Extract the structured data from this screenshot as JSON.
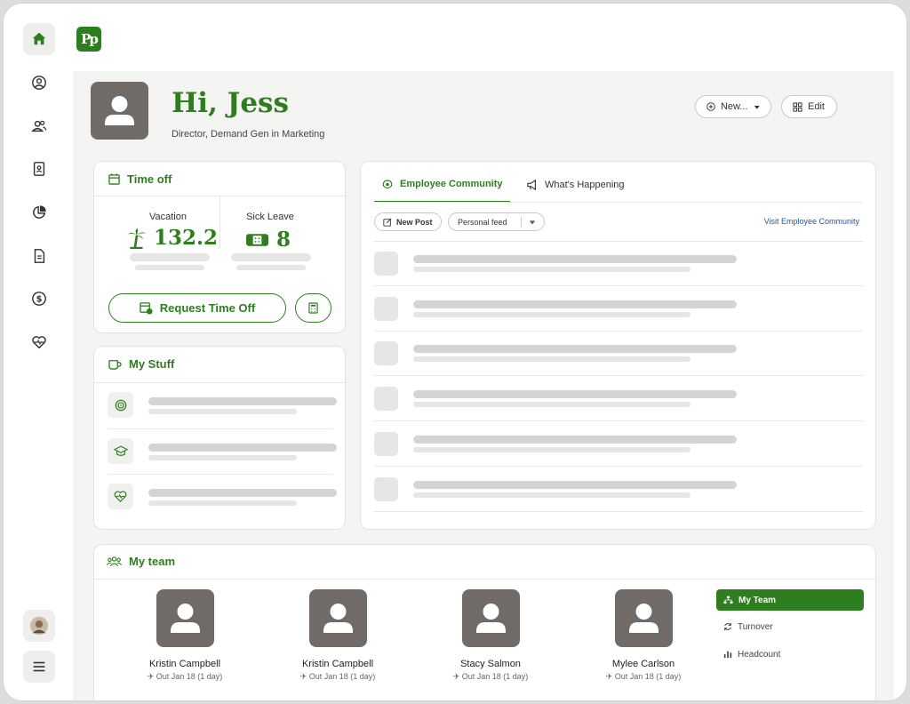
{
  "colors": {
    "brand": "#2e7d1e",
    "link": "#2456a6",
    "avatar": "#706b67"
  },
  "logo": {
    "text": "Pp"
  },
  "sidebar": {
    "items": [
      {
        "icon": "home-icon"
      },
      {
        "icon": "user-circle-icon"
      },
      {
        "icon": "people-icon"
      },
      {
        "icon": "contact-card-icon"
      },
      {
        "icon": "pie-chart-icon"
      },
      {
        "icon": "document-icon"
      },
      {
        "icon": "dollar-icon"
      },
      {
        "icon": "heart-pulse-icon"
      }
    ]
  },
  "header": {
    "greeting": "Hi, Jess",
    "subtitle": "Director, Demand Gen in Marketing",
    "new_label": "New...",
    "edit_label": "Edit"
  },
  "time_off": {
    "title": "Time off",
    "vacation_label": "Vacation",
    "vacation_value": "132.2",
    "sick_label": "Sick Leave",
    "sick_value": "8",
    "request_label": "Request Time Off"
  },
  "my_stuff": {
    "title": "My Stuff"
  },
  "community": {
    "tab_community": "Employee Community",
    "tab_happening": "What's Happening",
    "new_post": "New Post",
    "feed_select": "Personal feed",
    "visit_link": "Visit Employee Community"
  },
  "team": {
    "title": "My team",
    "members": [
      {
        "name": "Kristin Campbell",
        "status": "Out Jan 18 (1 day)"
      },
      {
        "name": "Kristin Campbell",
        "status": "Out Jan 18 (1 day)"
      },
      {
        "name": "Stacy Salmon",
        "status": "Out Jan 18 (1 day)"
      },
      {
        "name": "Mylee Carlson",
        "status": "Out Jan 18 (1 day)"
      }
    ],
    "options": {
      "my_team": "My Team",
      "turnover": "Turnover",
      "headcount": "Headcount"
    }
  }
}
